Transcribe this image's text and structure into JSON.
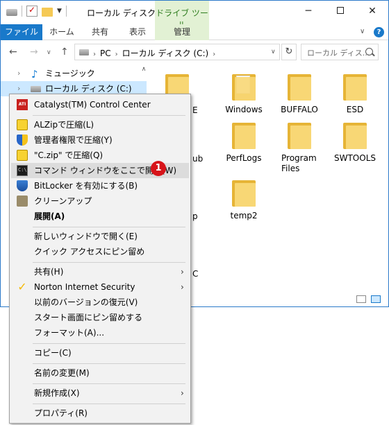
{
  "window": {
    "title": "ローカル ディスク (C:)",
    "context_tab": "ドライブ ツール",
    "minimize": "─",
    "close": "✕"
  },
  "ribbon": {
    "tabs": [
      "ファイル",
      "ホーム",
      "共有",
      "表示",
      "管理"
    ]
  },
  "address": {
    "path": [
      "PC",
      "ローカル ディスク (C:)"
    ],
    "refresh": "↻",
    "search_placeholder": "ローカル ディス..."
  },
  "nav_pane": {
    "items": [
      {
        "label": "ミュージック",
        "icon": "music-note-icon"
      },
      {
        "label": "ローカル ディスク (C:)",
        "icon": "drive-icon",
        "selected": true
      }
    ]
  },
  "files": {
    "items": [
      {
        "label": "Windows",
        "type": "folder"
      },
      {
        "label": "BUFFALO",
        "type": "folder"
      },
      {
        "label": "ESD",
        "type": "folder"
      },
      {
        "label": "PerfLogs",
        "type": "folder"
      },
      {
        "label": "Program Files",
        "type": "folder"
      },
      {
        "label": "SWTOOLS",
        "type": "folder"
      },
      {
        "label": "temp2",
        "type": "folder"
      }
    ],
    "partial_labels": [
      "E",
      "ub",
      "p",
      "C"
    ]
  },
  "context_menu": {
    "items": [
      {
        "label": "Catalyst(TM) Control Center",
        "icon": "ati-icon"
      },
      {
        "label": "ALZipで圧縮(L)",
        "icon": "alzip-icon"
      },
      {
        "label": "管理者権限で圧縮(Y)",
        "icon": "alzip-shield-icon"
      },
      {
        "label": "\"C.zip\" で圧縮(Q)",
        "icon": "alzip-icon"
      },
      {
        "label": "コマンド ウィンドウをここで開く(W)",
        "icon": "cmd-icon",
        "highlighted": true
      },
      {
        "label": "BitLocker を有効にする(B)",
        "icon": "bitlocker-shield-icon"
      },
      {
        "label": "クリーンアップ",
        "icon": "cleanup-icon"
      },
      {
        "label": "展開(A)",
        "bold": true
      },
      {
        "label": "新しいウィンドウで開く(E)"
      },
      {
        "label": "クイック アクセスにピン留め"
      },
      {
        "label": "共有(H)",
        "submenu": true
      },
      {
        "label": "Norton Internet Security",
        "icon": "norton-check-icon",
        "submenu": true
      },
      {
        "label": "以前のバージョンの復元(V)"
      },
      {
        "label": "スタート画面にピン留めする"
      },
      {
        "label": "フォーマット(A)..."
      },
      {
        "label": "コピー(C)"
      },
      {
        "label": "名前の変更(M)"
      },
      {
        "label": "新規作成(X)",
        "submenu": true
      },
      {
        "label": "プロパティ(R)"
      }
    ],
    "badge": "1"
  },
  "colors": {
    "accent": "#1979ca",
    "context_tab_bg": "#e2f1d4",
    "badge": "#d7141a",
    "menu_bg": "#f2f2f2"
  }
}
